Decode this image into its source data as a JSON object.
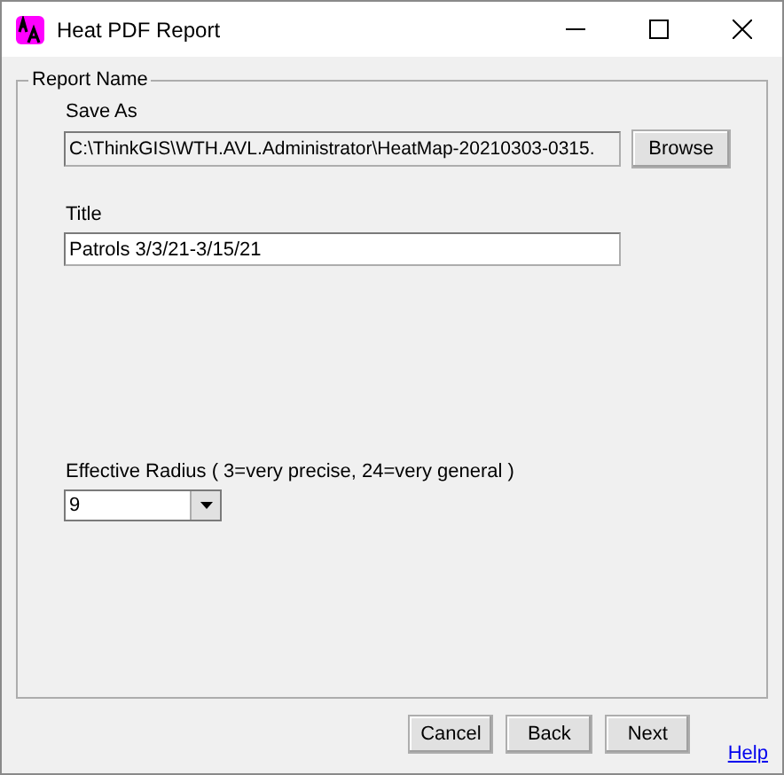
{
  "window": {
    "title": "Heat PDF Report"
  },
  "group": {
    "legend": "Report Name"
  },
  "save_as": {
    "label": "Save As",
    "value": "C:\\ThinkGIS\\WTH.AVL.Administrator\\HeatMap-20210303-0315.",
    "button": "Browse"
  },
  "title_field": {
    "label": "Title",
    "value": "Patrols 3/3/21-3/15/21"
  },
  "radius": {
    "label": "Effective Radius ( 3=very precise, 24=very general )",
    "value": "9"
  },
  "buttons": [
    {
      "label": "Cancel"
    },
    {
      "label": "Back"
    },
    {
      "label": "Next"
    }
  ],
  "help_link": "Help"
}
